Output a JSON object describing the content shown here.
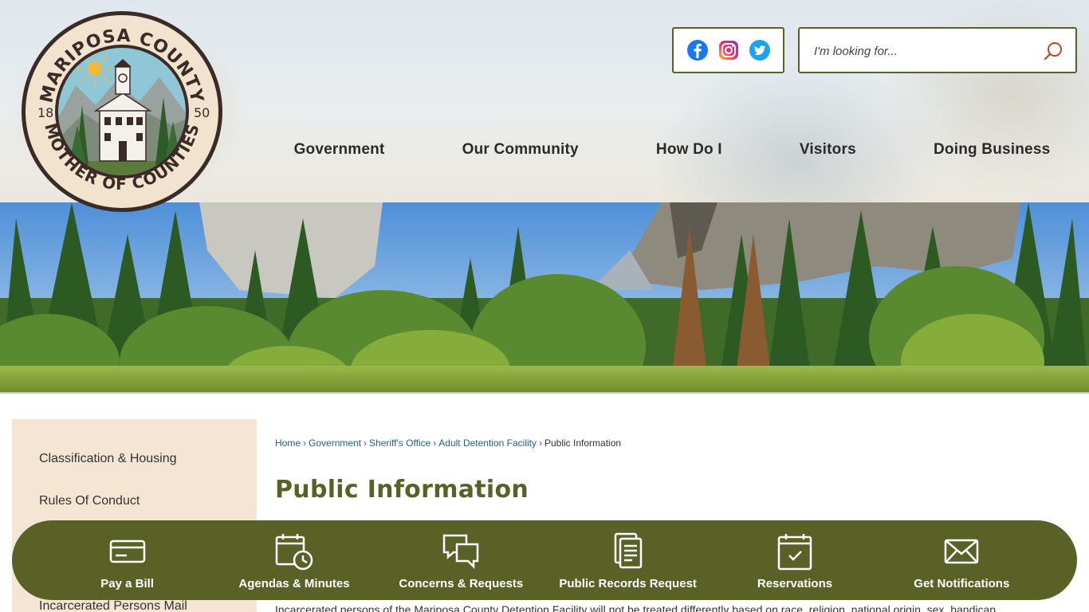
{
  "logo": {
    "top_text": "MARIPOSA COUNTY",
    "bottom_text": "MOTHER OF COUNTIES",
    "year_left": "18",
    "year_right": "50"
  },
  "social": {
    "items": [
      {
        "name": "Facebook",
        "icon": "facebook-icon",
        "color": "#1877f2"
      },
      {
        "name": "Instagram",
        "icon": "instagram-icon",
        "color": "#d6249f"
      },
      {
        "name": "Twitter",
        "icon": "twitter-icon",
        "color": "#1da1f2"
      }
    ]
  },
  "search": {
    "placeholder": "I'm looking for...",
    "icon": "search-icon"
  },
  "nav": {
    "items": [
      {
        "label": "Government"
      },
      {
        "label": "Our Community"
      },
      {
        "label": "How Do I"
      },
      {
        "label": "Visitors"
      },
      {
        "label": "Doing Business"
      }
    ]
  },
  "sidebar": {
    "items": [
      {
        "label": "Classification & Housing"
      },
      {
        "label": "Rules Of Conduct"
      },
      {
        "label": "Incarcerated Persons Mail"
      }
    ]
  },
  "breadcrumb": {
    "items": [
      {
        "label": "Home"
      },
      {
        "label": "Government"
      },
      {
        "label": "Sheriff's Office"
      },
      {
        "label": "Adult Detention Facility"
      }
    ],
    "current": "Public Information",
    "separator": "›"
  },
  "page": {
    "title": "Public Information",
    "body": "Incarcerated persons of the Mariposa County Detention Facility will not be treated differently based on race, religion, national origin, sex, handicap"
  },
  "quicklinks": {
    "items": [
      {
        "label": "Pay a Bill",
        "icon": "credit-card-icon"
      },
      {
        "label": "Agendas & Minutes",
        "icon": "calendar-clock-icon"
      },
      {
        "label": "Concerns & Requests",
        "icon": "chat-bubbles-icon"
      },
      {
        "label": "Public Records Request",
        "icon": "documents-icon"
      },
      {
        "label": "Reservations",
        "icon": "calendar-check-icon"
      },
      {
        "label": "Get Notifications",
        "icon": "envelope-icon"
      }
    ]
  },
  "colors": {
    "accent_olive": "#5a6126",
    "sidebar_bg": "#f5e6d3",
    "link_blue": "#1f5e8c"
  }
}
